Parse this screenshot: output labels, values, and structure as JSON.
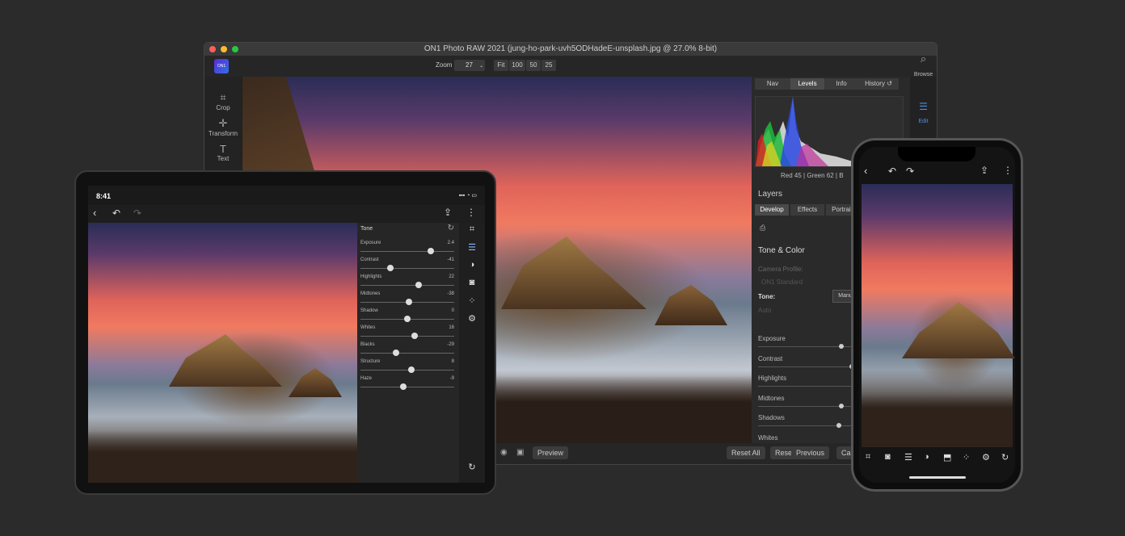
{
  "desktop": {
    "title": "ON1 Photo RAW 2021 (jung-ho-park-uvh5ODHadeE-unsplash.jpg @ 27.0% 8-bit)",
    "logo_text": "ON1",
    "zoom_label": "Zoom",
    "zoom_value": "27",
    "zoom_buttons": [
      "Fit",
      "100",
      "50",
      "25"
    ],
    "left_tools": [
      {
        "label": "Crop",
        "icon": "crop-icon"
      },
      {
        "label": "Transform",
        "icon": "move-icon"
      },
      {
        "label": "Text",
        "icon": "text-icon"
      }
    ],
    "right_tabs": [
      "Nav",
      "Levels",
      "Info",
      "History"
    ],
    "far_right": [
      {
        "label": "Browse",
        "icon": "browse-icon"
      },
      {
        "label": "Edit",
        "icon": "edit-icon"
      }
    ],
    "readout": "Red  45  | Green  62  | B",
    "layers_label": "Layers",
    "module_tabs": [
      "Develop",
      "Effects",
      "Portrait"
    ],
    "section_title": "Tone & Color",
    "camera_profile_label": "Camera Profile:",
    "camera_profile_value": "ON1 Standard",
    "tone_label": "Tone:",
    "tone_mode": "Manu",
    "auto_label": "Auto",
    "sliders": [
      {
        "label": "Exposure",
        "value": 0.5
      },
      {
        "label": "Contrast",
        "value": 0.58
      },
      {
        "label": "Highlights",
        "value": 0.63
      },
      {
        "label": "Midtones",
        "value": 0.5
      },
      {
        "label": "Shadows",
        "value": 0.48
      },
      {
        "label": "Whites",
        "value": 0.5
      }
    ],
    "bottom_buttons": {
      "preview": "Preview",
      "reset_all": "Reset All",
      "reset": "Reset",
      "previous": "Previous",
      "cancel": "Ca"
    }
  },
  "tablet": {
    "time": "8:41",
    "status_icons": "▪▪▪ ◔ ▭",
    "panel_title": "Tone",
    "sliders": [
      {
        "label": "Exposure",
        "display": "2.4",
        "value": 0.75
      },
      {
        "label": "Contrast",
        "display": "-41",
        "value": 0.32
      },
      {
        "label": "Highlights",
        "display": "22",
        "value": 0.62
      },
      {
        "label": "Midtones",
        "display": "-38",
        "value": 0.52
      },
      {
        "label": "Shadow",
        "display": "0",
        "value": 0.5
      },
      {
        "label": "Whites",
        "display": "16",
        "value": 0.58
      },
      {
        "label": "Blacks",
        "display": "-29",
        "value": 0.38
      },
      {
        "label": "Structure",
        "display": "8",
        "value": 0.54
      },
      {
        "label": "Haze",
        "display": "-9",
        "value": 0.46
      }
    ]
  },
  "phone": {
    "tool_icons": [
      "crop-icon",
      "camera-icon",
      "sliders-icon",
      "mask-icon",
      "export-icon",
      "heal-icon",
      "gear-icon",
      "revert-icon"
    ]
  },
  "colors": {
    "background": "#2b2b2b",
    "accent": "#4a8fe8"
  }
}
